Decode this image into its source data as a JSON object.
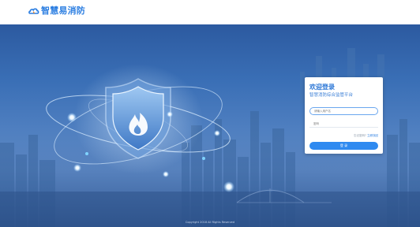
{
  "brand": {
    "name": "智慧易消防"
  },
  "login": {
    "title": "欢迎登录",
    "subtitle": "智慧消防综合监管平台",
    "username_placeholder": "请输入用户名",
    "password_placeholder": "密码",
    "forgot_prefix": "忘记密码?",
    "forgot_link": "立即找回",
    "submit_label": "登 录"
  },
  "footer": {
    "copyright": "Copyright 2018 All Rights Reserved"
  },
  "colors": {
    "brand": "#2a7de1",
    "hero_top": "#2c5aa0",
    "hero_mid": "#4f7fc0",
    "button": "#2f8af0"
  },
  "icons": {
    "logo": "cloud-flame-icon",
    "hero": "shield-flame-icon"
  }
}
